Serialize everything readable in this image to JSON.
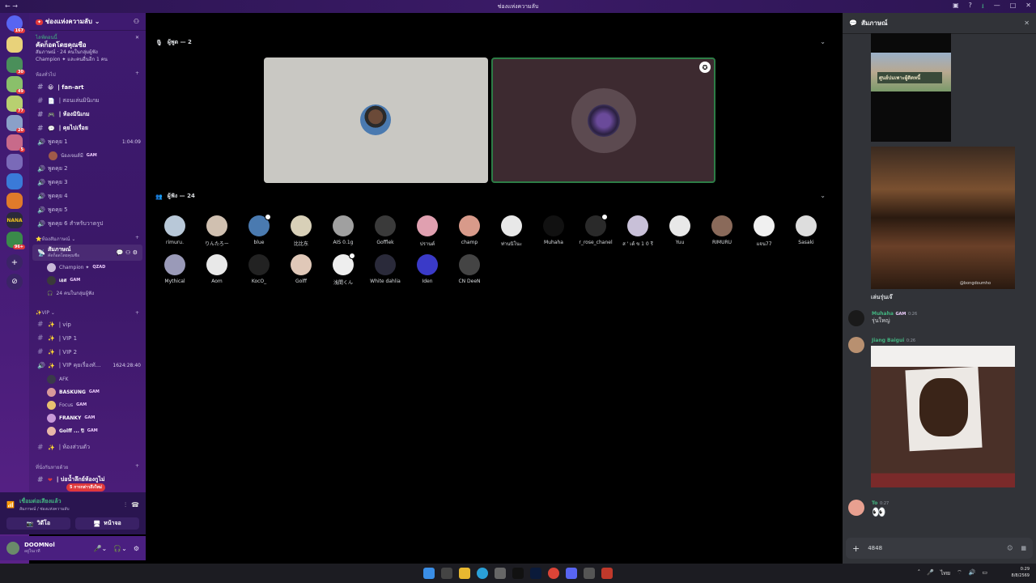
{
  "window": {
    "title": "ช่องแห่งความลับ",
    "back": "←  →"
  },
  "servers": {
    "badges": [
      "167",
      "30",
      "49",
      "77",
      "20",
      "5",
      "96+"
    ],
    "logo_text": "NANA"
  },
  "server": {
    "name": "ช่องแห่งความลับ"
  },
  "event": {
    "status": "ไลฟ์ตอนนี้",
    "title": "คัดก็อดโดยคุณซือ",
    "line1": "สัมภาษณ์ · 24 คนในกลุ่มผู้ฟัง",
    "line2": "Champion ✦ และคนอื่นอีก 1 คน"
  },
  "categories": {
    "general": "ห้องทั่วไป",
    "interview": "ห้องสัมภาษณ์",
    "vip": "VIP",
    "last": "ที่นั่งกันหายด้วย"
  },
  "text_channels": [
    "| fan-art",
    "| สอนเล่นมินิเกม",
    "| ห้องมินิเกม",
    "| คุยไปเรื่อย"
  ],
  "voice_talk": {
    "name": "พูดคุย 1",
    "time": "1:04:09",
    "member": "น้องเจมส์มี",
    "member_tag": "GAM"
  },
  "voice_channels": [
    "พูดคุย 2",
    "พูดคุย 3",
    "พูดคุย 4",
    "พูดคุย 5",
    "พูดคุย 6 สำหรับวาดรูป"
  ],
  "stage_channel": {
    "name": "สัมภาษณ์",
    "topic": "คัดก็อดโดยคุณซือ",
    "members": [
      {
        "name": "Champion ✦",
        "tag": "QZAD"
      },
      {
        "name": "เอส",
        "tag": "GAM"
      }
    ],
    "listeners": "24 คนในกลุ่มผู้ฟัง"
  },
  "vip_channels": [
    "| vip",
    "| VIP 1",
    "| VIP 2"
  ],
  "vip_voice": {
    "name": "| VIP คุยเรื่องทั...",
    "time": "1624:28:40",
    "members": [
      {
        "name": "AFK",
        "tag": ""
      },
      {
        "name": "BASKUNG",
        "tag": "GAM"
      },
      {
        "name": "Focus",
        "tag": "GAM"
      },
      {
        "name": "FRANKY",
        "tag": "GAM"
      },
      {
        "name": "Golff ... ปิ",
        "tag": "GAM"
      }
    ]
  },
  "vip_extra": "| ห้องส่วนตัว",
  "last_channel": "| บ่อน้ำลึกย์ห้องกูไม่",
  "new_messages": "5 การกล่าวถึงใหม่",
  "voice_status": {
    "title": "เชื่อมต่อเสียงแล้ว",
    "sub": "สัมภาษณ์ / ช่องแห่งความลับ",
    "video": "วิดีโอ",
    "screen": "หน้าจอ"
  },
  "user": {
    "name": "DOOMNol",
    "status": "อยู่ในเวที"
  },
  "stage": {
    "speakers_label": "ผู้พูด — 2",
    "audience_label": "ผู้ฟัง — 24"
  },
  "audience": [
    "rimuru.",
    "りんたろー",
    "blue",
    "比比东",
    "AIS 0.1g",
    "Gofflek",
    "ปรานต์",
    "champ",
    "ท่านนิโนะ",
    "Muhaha",
    "r_rose_chanel",
    "ส ' เด้ ข 1 0 รี",
    "Yuu",
    "RIMURU",
    "แจน77",
    "Sasaki",
    "Mythical",
    "Aom",
    "KocO_",
    "Golff",
    "浅間くん",
    "White dahlia",
    "Iden",
    "CN DeeN"
  ],
  "chat": {
    "title": "สัมภาษณ์",
    "image1_caption": "ศูนย์บ่มเพาะผู้ติดหนี้",
    "watermark": "@bongdoumho",
    "caption": "เล่นรุ่นเจ๊",
    "msg1": {
      "name": "Muhaha",
      "tag": "GAM",
      "time": "0:26",
      "text": "รุ่นใหญ่"
    },
    "msg2": {
      "name": "Jiang Baigui",
      "time": "0:26"
    },
    "msg3": {
      "name": "To",
      "time": "0:27",
      "text": "👀"
    },
    "composer": "4848"
  },
  "tray": {
    "time": "0:29",
    "date": "8/8/2569",
    "lang": "ไทย"
  },
  "colors": {
    "accent": "#5865f2",
    "online": "#43b581",
    "speaking": "#2d7d46"
  }
}
